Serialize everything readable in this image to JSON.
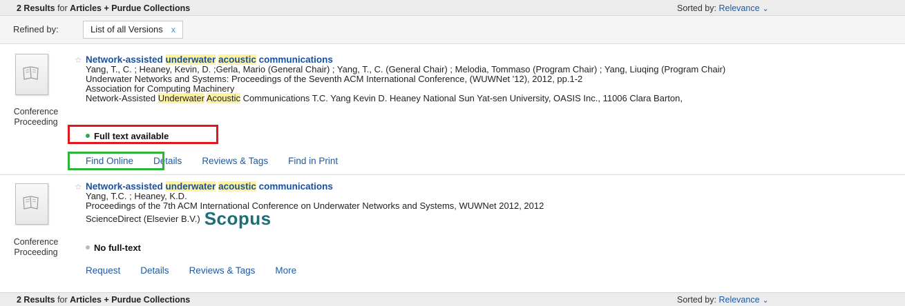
{
  "header": {
    "count": "2 Results",
    "for_word": "for",
    "scope": "Articles + Purdue Collections",
    "sorted_label": "Sorted by:",
    "sorted_value": "Relevance"
  },
  "refine": {
    "label": "Refined by:",
    "chip_label": "List of all Versions",
    "chip_remove": "x"
  },
  "results": [
    {
      "type_line1": "Conference",
      "type_line2": "Proceeding",
      "title_parts": [
        "Network-assisted ",
        "underwater",
        " ",
        "acoustic",
        " communications"
      ],
      "authors": "Yang, T., C. ; Heaney, Kevin, D. ;Gerla, Mario (General Chair) ; Yang, T., C. (General Chair) ; Melodia, Tommaso (Program Chair) ; Yang, Liuqing (Program Chair)",
      "source": "Underwater Networks and Systems: Proceedings of the Seventh ACM International Conference, (WUWNet '12), 2012, pp.1-2",
      "publisher": "Association for Computing Machinery",
      "snippet_parts": [
        "Network-Assisted ",
        "Underwater",
        " ",
        "Acoustic",
        " Communications T.C. Yang Kevin D. Heaney National Sun Yat-sen University, OASIS Inc., 11006 Clara Barton,"
      ],
      "availability": "Full text available",
      "availability_color": "#2fa84f",
      "actions": [
        "Find Online",
        "Details",
        "Reviews & Tags",
        "Find in Print"
      ]
    },
    {
      "type_line1": "Conference",
      "type_line2": "Proceeding",
      "title_parts": [
        "Network-assisted ",
        "underwater",
        " ",
        "acoustic",
        " communications"
      ],
      "authors": "Yang, T.C. ; Heaney, K.D.",
      "source": "Proceedings of the 7th ACM International Conference on Underwater Networks and Systems, WUWNet 2012, 2012",
      "publisher": "ScienceDirect (Elsevier B.V.)",
      "logo_text": "Scopus",
      "availability": "No full-text",
      "availability_color": "#bbbbbb",
      "actions": [
        "Request",
        "Details",
        "Reviews & Tags",
        "More"
      ]
    }
  ],
  "colors": {
    "link": "#1a5aa6",
    "highlight": "#fff3a0",
    "annotation_red": "#e3161b",
    "annotation_green": "#2fb43a"
  },
  "icons": {
    "thumb": "book-icon",
    "star": "star-outline-icon",
    "chevron": "chevron-down-icon"
  }
}
